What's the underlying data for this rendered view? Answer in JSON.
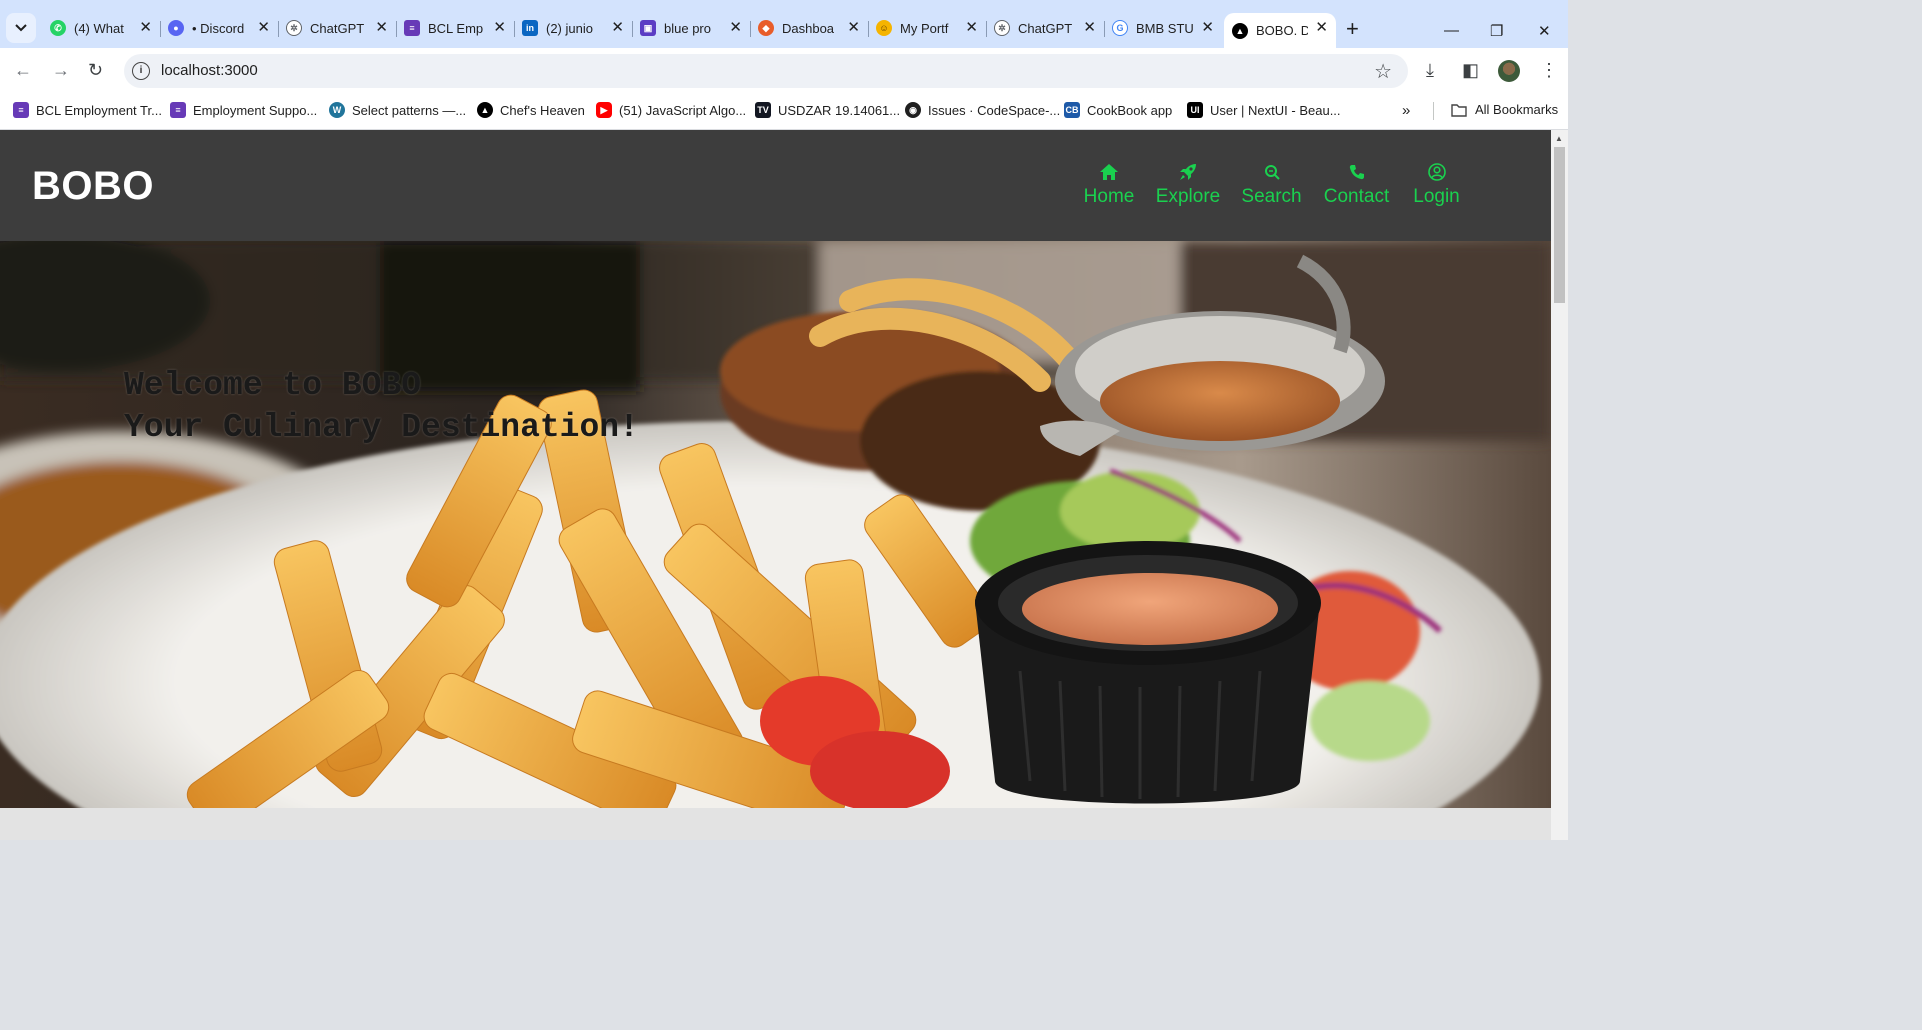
{
  "browser": {
    "tabs": [
      {
        "title": "(4) What",
        "icon": "whatsapp-icon",
        "color": "#25d366"
      },
      {
        "title": "• Discord",
        "icon": "discord-icon",
        "color": "#5865f2"
      },
      {
        "title": "ChatGPT",
        "icon": "chatgpt-icon",
        "color": "#10a37f"
      },
      {
        "title": "BCL Emp",
        "icon": "forms-icon",
        "color": "#673ab7"
      },
      {
        "title": "(2) junio",
        "icon": "linkedin-icon",
        "color": "#0a66c2"
      },
      {
        "title": "blue pro",
        "icon": "app-icon",
        "color": "#5b3cc4"
      },
      {
        "title": "Dashboa",
        "icon": "dashboard-icon",
        "color": "#e85d2a"
      },
      {
        "title": "My Portf",
        "icon": "emoji-icon",
        "color": "#f5b400"
      },
      {
        "title": "ChatGPT",
        "icon": "chatgpt-icon",
        "color": "#10a37f"
      },
      {
        "title": "BMB STU",
        "icon": "google-icon",
        "color": "#4285f4"
      },
      {
        "title": "BOBO. D",
        "icon": "triangle-icon",
        "color": "#000000"
      }
    ],
    "address": "localhost:3000",
    "bookmarks": [
      {
        "label": "BCL Employment Tr...",
        "icon": "forms-icon",
        "color": "#673ab7"
      },
      {
        "label": "Employment Suppo...",
        "icon": "forms-icon",
        "color": "#673ab7"
      },
      {
        "label": "Select patterns —...",
        "icon": "wordpress-icon",
        "color": "#21759b"
      },
      {
        "label": "Chef's Heaven",
        "icon": "triangle-icon",
        "color": "#000000"
      },
      {
        "label": "(51) JavaScript Algo...",
        "icon": "youtube-icon",
        "color": "#ff0000"
      },
      {
        "label": "USDZAR 19.14061...",
        "icon": "tradingview-icon",
        "color": "#131722"
      },
      {
        "label": "Issues · CodeSpace-...",
        "icon": "github-icon",
        "color": "#1f1f1f"
      },
      {
        "label": "CookBook app",
        "icon": "cookbook-icon",
        "color": "#1e5aa8"
      },
      {
        "label": "User | NextUI - Beau...",
        "icon": "nextui-icon",
        "color": "#000000"
      }
    ],
    "all_bookmarks": "All Bookmarks"
  },
  "site": {
    "logo": "BOBO",
    "accent": "#1ad14f",
    "nav": [
      {
        "label": "Home",
        "icon": "home-icon"
      },
      {
        "label": "Explore",
        "icon": "rocket-icon"
      },
      {
        "label": "Search",
        "icon": "search-icon"
      },
      {
        "label": "Contact",
        "icon": "phone-icon"
      },
      {
        "label": "Login",
        "icon": "user-circle-icon"
      }
    ],
    "hero": {
      "line1": "Welcome to BOBO",
      "line2": "Your Culinary Destination!"
    }
  }
}
